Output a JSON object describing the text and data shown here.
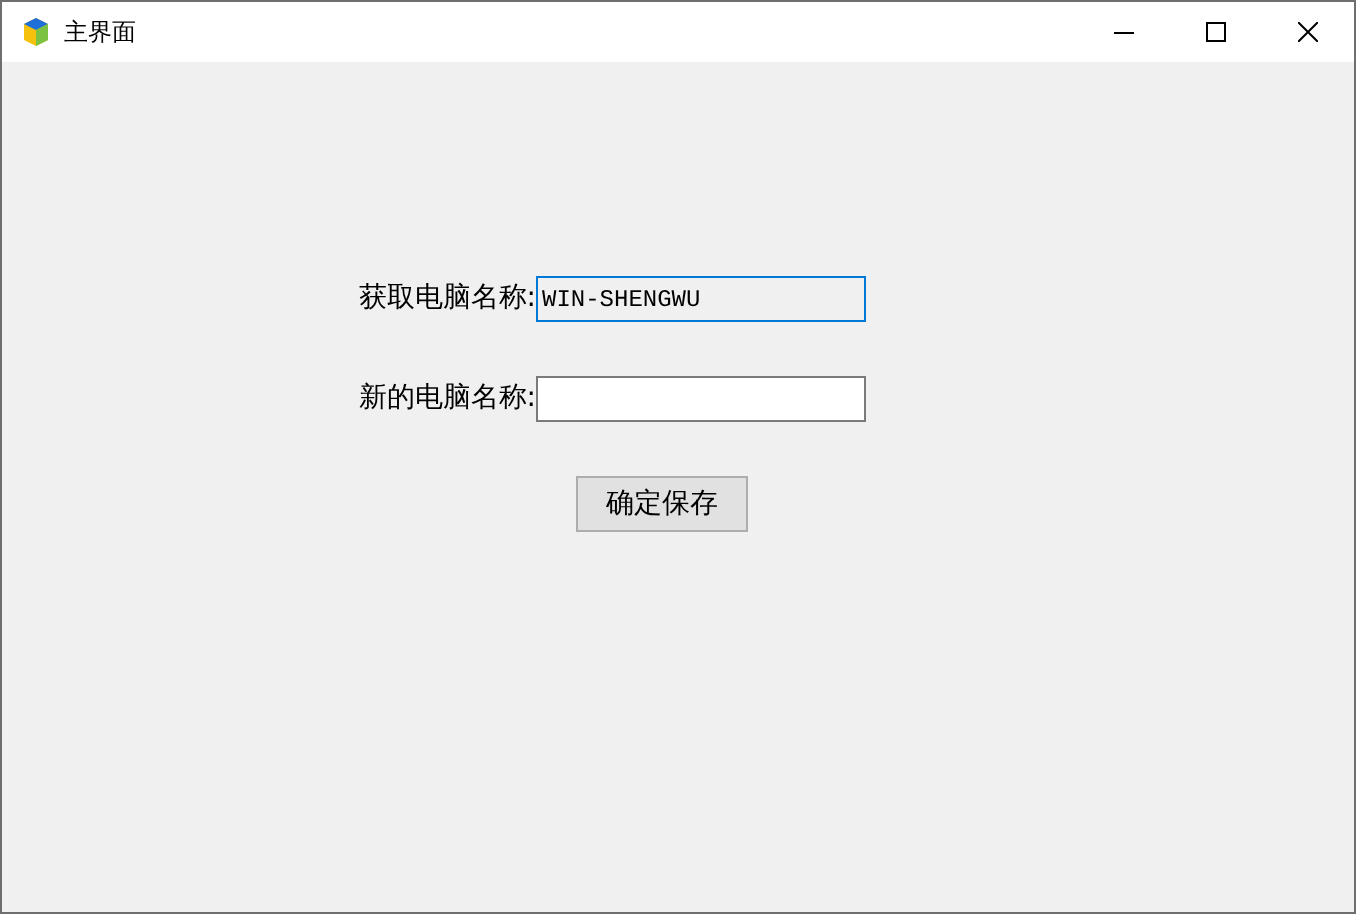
{
  "window": {
    "title": "主界面"
  },
  "fields": [
    {
      "label": "获取电脑名称:",
      "value": "WIN-SHENGWU",
      "readonly": true,
      "focused": true
    },
    {
      "label": "新的电脑名称:",
      "readonly": false,
      "focused": false
    }
  ],
  "buttons": [
    {
      "label": "确定保存"
    }
  ]
}
